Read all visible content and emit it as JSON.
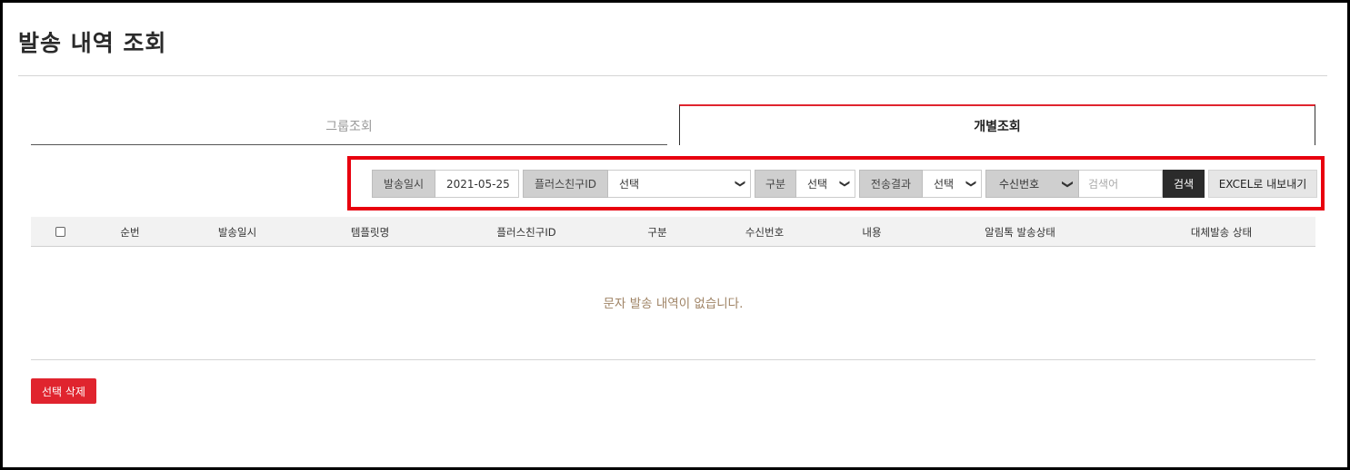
{
  "page": {
    "title": "발송 내역 조회"
  },
  "tabs": [
    {
      "label": "그룹조회",
      "active": false
    },
    {
      "label": "개별조회",
      "active": true
    }
  ],
  "filters": {
    "date_label": "발송일시",
    "date_value": "2021-05-25",
    "plusfriend_label": "플러스친구ID",
    "plusfriend_value": "선택",
    "category_label": "구분",
    "category_value": "선택",
    "result_label": "전송결과",
    "result_value": "선택",
    "phone_select_value": "수신번호",
    "search_placeholder": "검색어",
    "search_button": "검색",
    "excel_button": "EXCEL로 내보내기"
  },
  "table": {
    "columns": [
      "순번",
      "발송일시",
      "템플릿명",
      "플러스친구ID",
      "구분",
      "수신번호",
      "내용",
      "알림톡 발송상태",
      "대체발송 상태"
    ],
    "empty_message": "문자 발송 내역이 없습니다."
  },
  "actions": {
    "delete_button": "선택 삭제"
  },
  "colors": {
    "accent": "#e0242e",
    "highlight_border": "#e8000e",
    "search_button": "#2b2b2b"
  }
}
